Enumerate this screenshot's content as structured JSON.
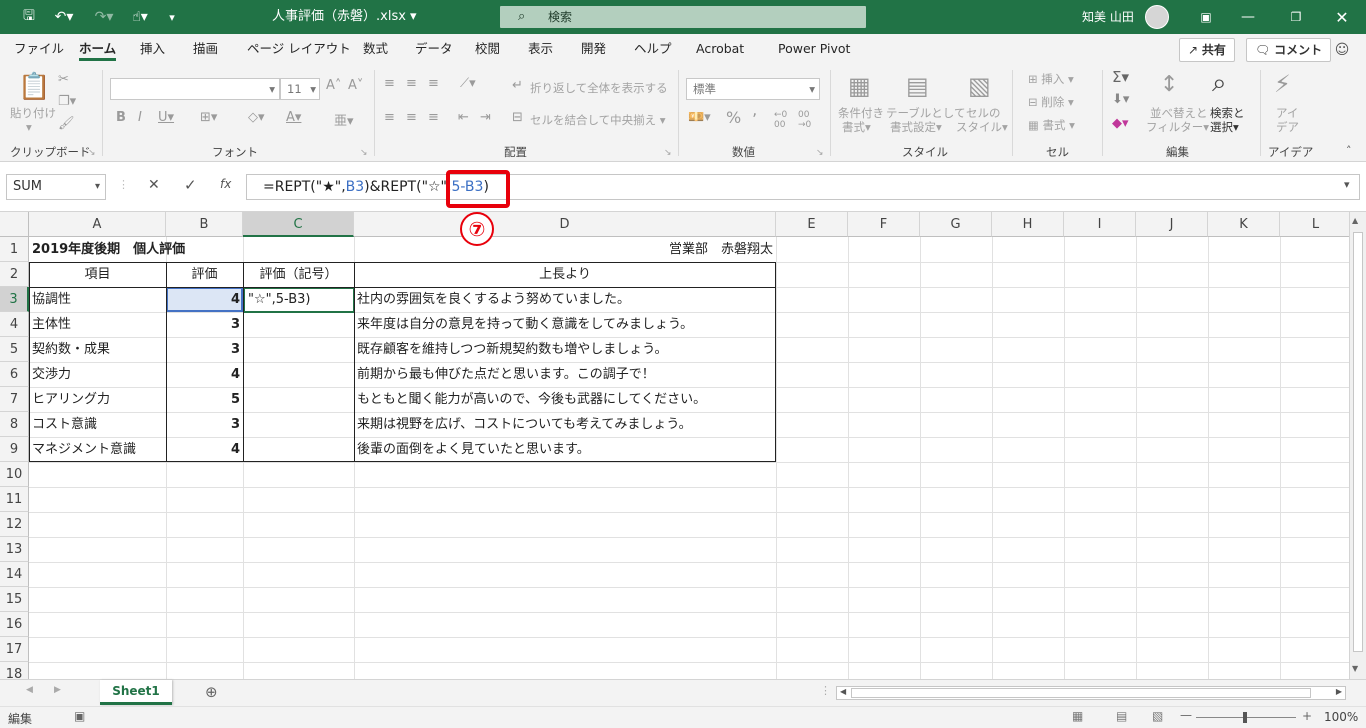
{
  "title": "人事評価（赤磐）.xlsx",
  "search_placeholder": "検索",
  "user": "知美 山田",
  "tabs": [
    "ファイル",
    "ホーム",
    "挿入",
    "描画",
    "ページ レイアウト",
    "数式",
    "データ",
    "校閲",
    "表示",
    "開発",
    "ヘルプ",
    "Acrobat",
    "Power Pivot"
  ],
  "active_tab": "ホーム",
  "share": "共有",
  "comment": "コメント",
  "ribbon": {
    "clipboard": "クリップボード",
    "paste": "貼り付け",
    "font": "フォント",
    "font_size": "11",
    "alignment": "配置",
    "wrap": "折り返して全体を表示する",
    "merge": "セルを結合して中央揃え",
    "number": "数値",
    "number_format": "標準",
    "styles": "スタイル",
    "cond_l1": "条件付き",
    "cond_l2": "書式",
    "table_l1": "テーブルとして",
    "table_l2": "書式設定",
    "cellstyle_l1": "セルの",
    "cellstyle_l2": "スタイル",
    "cells": "セル",
    "insert": "挿入",
    "delete": "削除",
    "format": "書式",
    "editing": "編集",
    "sort_l1": "並べ替えと",
    "sort_l2": "フィルター",
    "find_l1": "検索と",
    "find_l2": "選択",
    "ideas": "アイデア",
    "ideas_l1": "アイ",
    "ideas_l2": "デア"
  },
  "namebox": "SUM",
  "formula": {
    "p1": "=REPT(\"★\",",
    "p2": "B3",
    "p3": ")&REPT(\"☆\",",
    "p4": "5-B3",
    "p5": ")"
  },
  "badge": "⑦",
  "columns": [
    "A",
    "B",
    "C",
    "D",
    "E",
    "F",
    "G",
    "H",
    "I",
    "J",
    "K",
    "L"
  ],
  "rows": [
    "1",
    "2",
    "3",
    "4",
    "5",
    "6",
    "7",
    "8",
    "9",
    "10",
    "11",
    "12",
    "13",
    "14",
    "15",
    "16",
    "17",
    "18"
  ],
  "sheet": {
    "title": "2019年度後期　個人評価",
    "dept": "営業部　赤磐翔太",
    "h_item": "項目",
    "h_score": "評価",
    "h_symbol": "評価（記号）",
    "h_comment": "上長より",
    "c3_edit": "\"☆\",5-B3)",
    "items": [
      {
        "item": "協調性",
        "score": "4",
        "comment": "社内の雰囲気を良くするよう努めていました。"
      },
      {
        "item": "主体性",
        "score": "3",
        "comment": "来年度は自分の意見を持って動く意識をしてみましょう。"
      },
      {
        "item": "契約数・成果",
        "score": "3",
        "comment": "既存顧客を維持しつつ新規契約数も増やしましょう。"
      },
      {
        "item": "交渉力",
        "score": "4",
        "comment": "前期から最も伸びた点だと思います。この調子で！"
      },
      {
        "item": "ヒアリング力",
        "score": "5",
        "comment": "もともと聞く能力が高いので、今後も武器にしてください。"
      },
      {
        "item": "コスト意識",
        "score": "3",
        "comment": "来期は視野を広げ、コストについても考えてみましょう。"
      },
      {
        "item": "マネジメント意識",
        "score": "4",
        "comment": "後輩の面倒をよく見ていたと思います。"
      }
    ]
  },
  "sheet_tab": "Sheet1",
  "status": "編集",
  "zoom": "100%"
}
